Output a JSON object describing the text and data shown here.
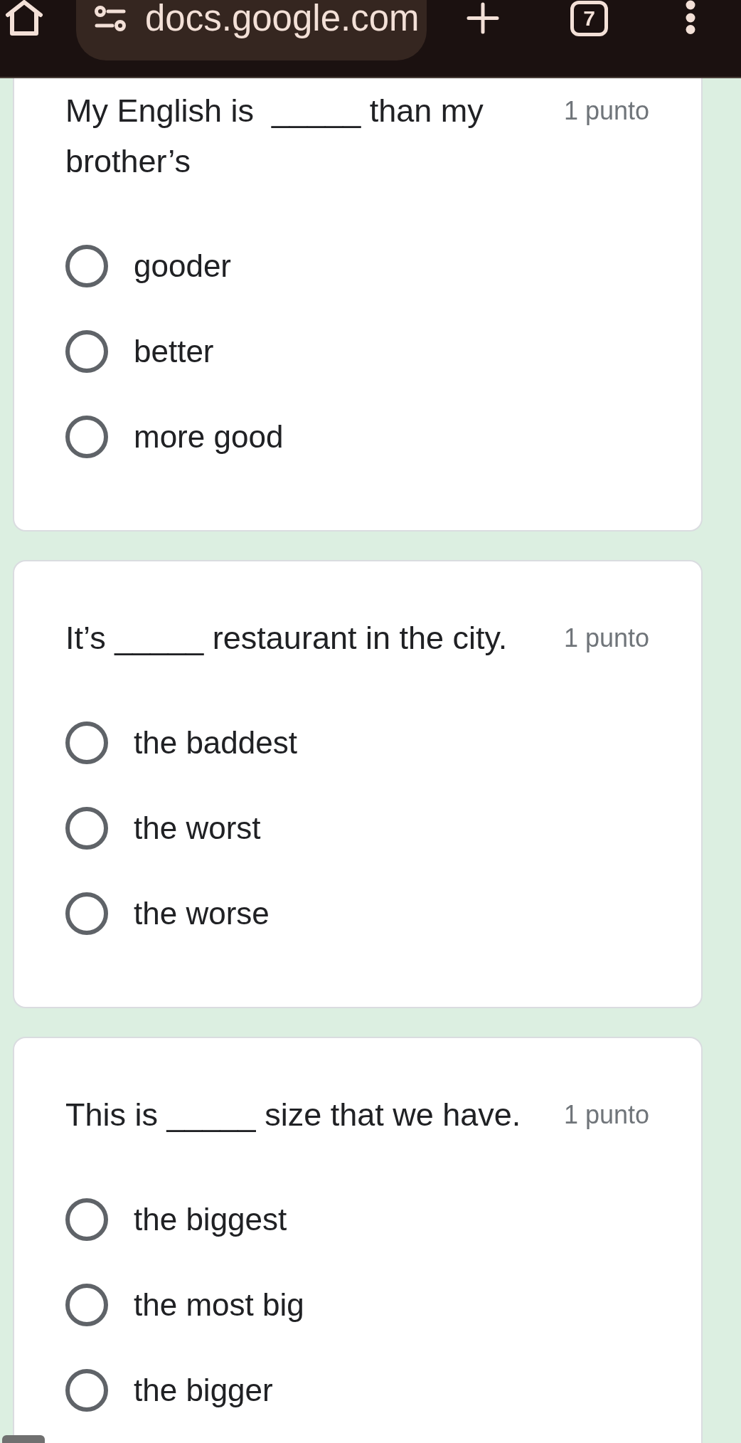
{
  "browser": {
    "url": "docs.google.com",
    "tab_count": "7"
  },
  "questions": [
    {
      "text": "My English is  _____ than my brother’s",
      "points": "1 punto",
      "options": [
        {
          "label": "gooder",
          "selected": false
        },
        {
          "label": "better",
          "selected": false
        },
        {
          "label": "more good",
          "selected": false
        }
      ]
    },
    {
      "text": "It’s _____ restaurant in the city.",
      "points": "1 punto",
      "options": [
        {
          "label": "the baddest",
          "selected": false
        },
        {
          "label": "the worst",
          "selected": false
        },
        {
          "label": "the worse",
          "selected": false
        }
      ]
    },
    {
      "text": "This is _____ size that we have.",
      "points": "1 punto",
      "options": [
        {
          "label": "the biggest",
          "selected": false
        },
        {
          "label": "the most big",
          "selected": false
        },
        {
          "label": "the bigger",
          "selected": false
        }
      ]
    }
  ]
}
